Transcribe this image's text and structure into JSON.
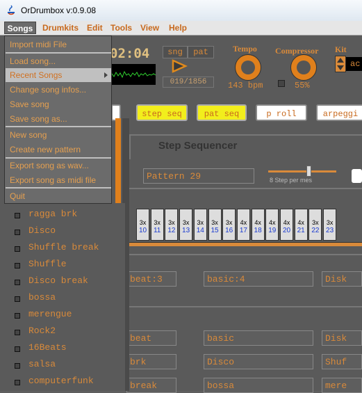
{
  "window": {
    "title": "OrDrumbox v:0.9.08"
  },
  "menubar": [
    "Songs",
    "Drumkits",
    "Edit",
    "Tools",
    "View",
    "Help"
  ],
  "songs_menu": {
    "items": [
      {
        "label": "Import midi File"
      },
      {
        "label": "Load song..."
      },
      {
        "label": "Recent Songs",
        "highlighted": true,
        "submenu": true
      },
      {
        "label": "Change song infos..."
      },
      {
        "label": "Save song"
      },
      {
        "label": "Save song as..."
      },
      {
        "label": "New song"
      },
      {
        "label": "Create new pattern"
      },
      {
        "label": "Export song as wav..."
      },
      {
        "label": "Export song as midi file"
      },
      {
        "label": "Quit"
      }
    ]
  },
  "transport": {
    "time": "02:04",
    "toggles": [
      "sng",
      "pat"
    ],
    "counter": "019/1856"
  },
  "tempo": {
    "label": "Tempo",
    "value": "143 bpm"
  },
  "compressor": {
    "label": "Compressor",
    "value": "55%"
  },
  "kit": {
    "label": "Kit",
    "value": "ac"
  },
  "modes": {
    "step_seq": "step seq",
    "pat_seq": "pat seq",
    "p_roll": "p roll",
    "arpeggi": "arpeggi"
  },
  "step_sequencer": {
    "title": "Step Sequencer",
    "pattern": "Pattern 29",
    "steps_caption": "8 Step per mes",
    "steps": [
      {
        "mult": "3x",
        "num": "10"
      },
      {
        "mult": "3x",
        "num": "11"
      },
      {
        "mult": "3x",
        "num": "12"
      },
      {
        "mult": "3x",
        "num": "13"
      },
      {
        "mult": "3x",
        "num": "14"
      },
      {
        "mult": "3x",
        "num": "15"
      },
      {
        "mult": "3x",
        "num": "16"
      },
      {
        "mult": "4x",
        "num": "17"
      },
      {
        "mult": "4x",
        "num": "18"
      },
      {
        "mult": "4x",
        "num": "19"
      },
      {
        "mult": "4x",
        "num": "20"
      },
      {
        "mult": "4x",
        "num": "21"
      },
      {
        "mult": "3x",
        "num": "22"
      },
      {
        "mult": "3x",
        "num": "23"
      }
    ]
  },
  "pattern_rows": [
    [
      "beat:3",
      "basic:4",
      "Disk"
    ],
    [
      "beat",
      "basic",
      "Disk"
    ],
    [
      "brk",
      "Disco",
      "Shuf"
    ],
    [
      "break",
      "bossa",
      "mere"
    ]
  ],
  "pattern_list": [
    "ragga brk",
    "Disco",
    "Shuffle break",
    "Shuffle",
    "Disco break",
    "bossa",
    "merengue",
    "Rock2",
    "16Beats",
    "salsa",
    "computerfunk"
  ]
}
